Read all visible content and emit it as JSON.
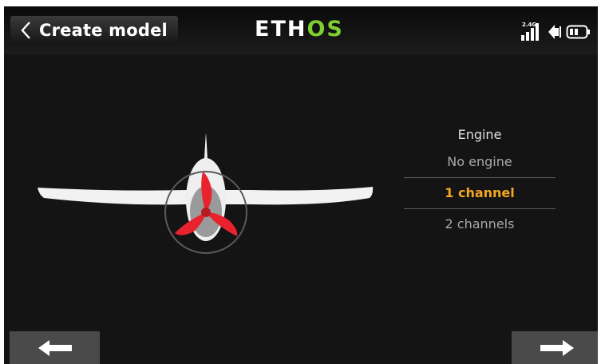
{
  "header": {
    "title": "Create model",
    "logo": {
      "part1": "ETH",
      "part2": "OS"
    },
    "status": {
      "rf_band": "2.4G",
      "signal_icon": "signal-bars-icon",
      "volume_icon": "speaker-icon",
      "battery_icon": "battery-icon"
    }
  },
  "engine": {
    "heading": "Engine",
    "options": [
      {
        "label": "No engine",
        "selected": false
      },
      {
        "label": "1 channel",
        "selected": true
      },
      {
        "label": "2 channels",
        "selected": false
      }
    ]
  },
  "nav": {
    "prev_icon": "arrow-left-icon",
    "next_icon": "arrow-right-icon"
  },
  "colors": {
    "accent": "#f5a623",
    "logo_accent": "#7fcf2f",
    "propeller": "#e8232e",
    "background": "#141414"
  }
}
